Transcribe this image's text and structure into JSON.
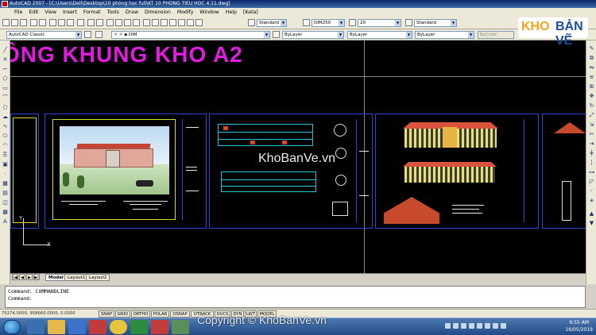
{
  "window": {
    "title": "AutoCAD 2007 - [C:\\Users\\Dell\\Desktop\\10 phòng học full\\KT 10 PHONG TIEU HOC 4.11.dwg]"
  },
  "menu": [
    "File",
    "Edit",
    "View",
    "Insert",
    "Format",
    "Tools",
    "Draw",
    "Dimension",
    "Modify",
    "Window",
    "Help",
    "[Kata]"
  ],
  "toolbar": {
    "dimstyle": "DIM250",
    "textheight": "20",
    "textstyle": "Standard",
    "workspace": "AutoCAD Classic",
    "layer": "DIM",
    "color": "ByLayer",
    "linetype": "ByLayer",
    "lineweight": "ByLayer",
    "plotstyle": "ByColor"
  },
  "drawing": {
    "big_title": "ÔNG KHUNG KHO A2",
    "watermark": "KhoBanVe.vn",
    "ucs_x": "X",
    "ucs_y": "Y"
  },
  "layout_tabs": [
    "Model",
    "Layout1",
    "Layout2"
  ],
  "command": {
    "line1": "Command: COMMANDLINE",
    "line2": "Command:"
  },
  "status": {
    "coords": "75274.0000, 958660.0000, 0.0000",
    "buttons": [
      "SNAP",
      "GRID",
      "ORTHO",
      "POLAR",
      "OSNAP",
      "OTRACK",
      "DUCS",
      "DYN",
      "LWT",
      "MODEL"
    ]
  },
  "taskbar": {
    "time": "9:55 AM",
    "date": "16/05/2019"
  },
  "watermark_bottom": "Copyright © KhoBanVe.vn",
  "logo": {
    "part1": "KHO",
    "part2": "BẢN VẼ"
  },
  "colors": {
    "canvas": "#000000",
    "title_magenta": "#e21be0",
    "frame_blue": "#2b45d8",
    "inner_yellow": "#d8d82a"
  }
}
